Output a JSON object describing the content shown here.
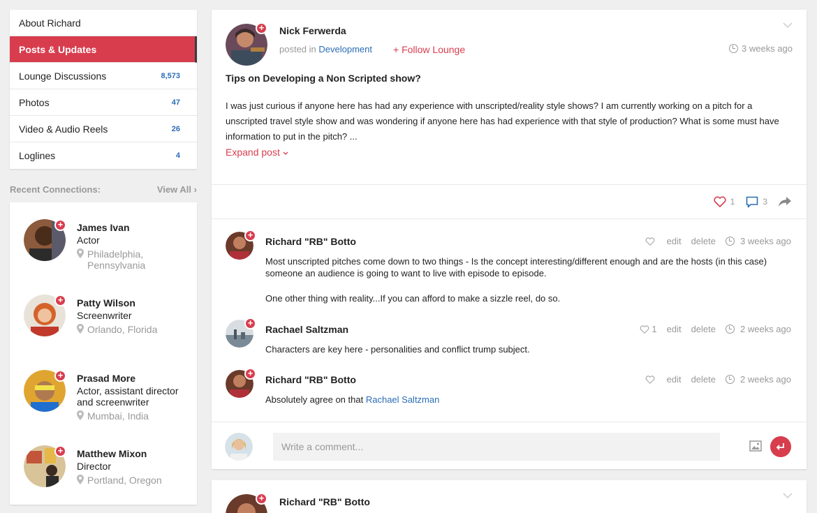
{
  "sidebar": {
    "items": [
      {
        "label": "About Richard",
        "count": ""
      },
      {
        "label": "Posts & Updates",
        "count": ""
      },
      {
        "label": "Lounge Discussions",
        "count": "8,573"
      },
      {
        "label": "Photos",
        "count": "47"
      },
      {
        "label": "Video & Audio Reels",
        "count": "26"
      },
      {
        "label": "Loglines",
        "count": "4"
      }
    ],
    "active_index": 1
  },
  "connections": {
    "heading": "Recent Connections:",
    "view_all": "View All",
    "people": [
      {
        "name": "James Ivan",
        "role": "Actor",
        "location": "Philadelphia, Pennsylvania"
      },
      {
        "name": "Patty Wilson",
        "role": "Screenwriter",
        "location": "Orlando, Florida"
      },
      {
        "name": "Prasad More",
        "role": "Actor, assistant director and screenwriter",
        "location": "Mumbai, India"
      },
      {
        "name": "Matthew Mixon",
        "role": "Director",
        "location": "Portland, Oregon"
      }
    ]
  },
  "post": {
    "author": "Nick Ferwerda",
    "posted_in_label": "posted in",
    "category": "Development",
    "follow_label": "+ Follow Lounge",
    "time": "3 weeks ago",
    "title": "Tips on Developing a Non Scripted show?",
    "body": "I was just curious if anyone here has had any experience with unscripted/reality style shows? I am currently working on a pitch for a unscripted travel style show and was wondering if anyone here has had experience with that style of production? What is some must have information to put in the pitch? ...",
    "expand_label": "Expand post",
    "likes": "1",
    "comments_count": "3"
  },
  "comments": [
    {
      "author": "Richard \"RB\" Botto",
      "likes": "",
      "edit": "edit",
      "delete": "delete",
      "time": "3 weeks ago",
      "paragraphs": [
        "Most unscripted pitches come down to two things - Is the concept interesting/different enough and are the hosts (in this case) someone an audience is going to want to live with episode to episode.",
        "One other thing with reality...If you can afford to make a sizzle reel, do so."
      ]
    },
    {
      "author": "Rachael Saltzman",
      "likes": "1",
      "edit": "edit",
      "delete": "delete",
      "time": "2 weeks ago",
      "paragraphs": [
        "Characters are key here - personalities and conflict trump subject."
      ]
    },
    {
      "author": "Richard \"RB\" Botto",
      "likes": "",
      "edit": "edit",
      "delete": "delete",
      "time": "2 weeks ago",
      "text_prefix": "Absolutely agree on that",
      "mention": "Rachael Saltzman"
    }
  ],
  "composer": {
    "placeholder": "Write a comment..."
  },
  "post2": {
    "author": "Richard \"RB\" Botto"
  },
  "colors": {
    "accent": "#d83d4e",
    "link": "#2a6db5",
    "muted": "#999999",
    "background": "#efefef"
  }
}
